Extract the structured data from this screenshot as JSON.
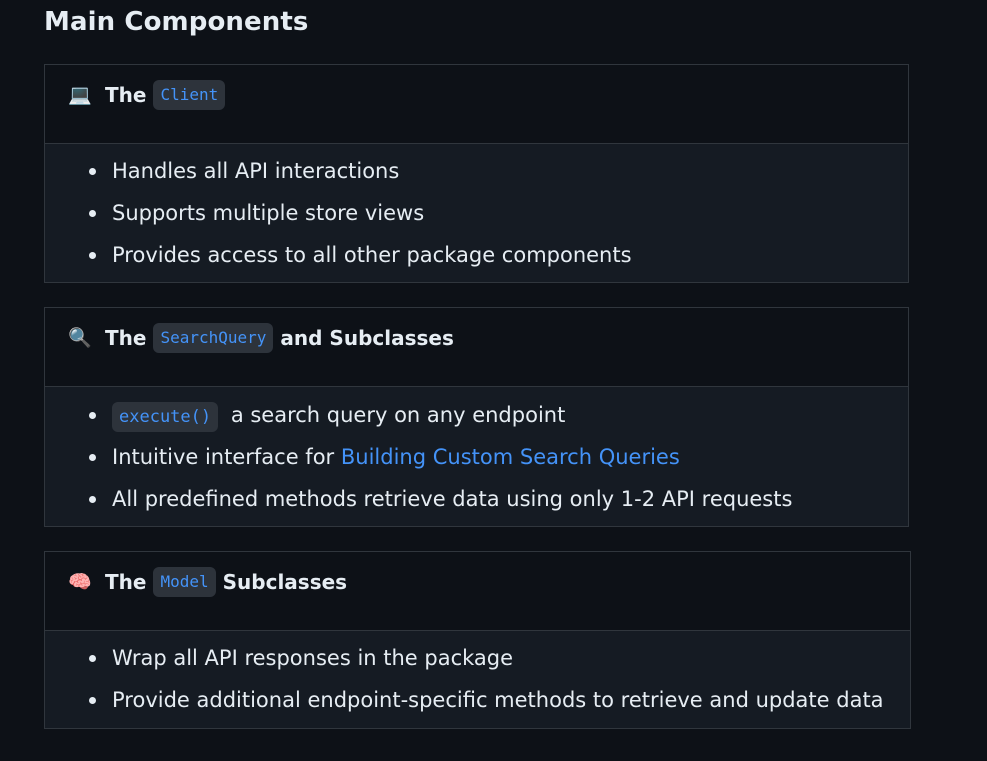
{
  "heading": "Main Components",
  "cards": [
    {
      "emoji": "💻",
      "title_prefix": "The",
      "code": "Client",
      "title_suffix": "",
      "items": [
        {
          "text": "Handles all API interactions"
        },
        {
          "text": "Supports multiple store views"
        },
        {
          "text": "Provides access to all other package components"
        }
      ]
    },
    {
      "emoji": "🔍",
      "title_prefix": "The",
      "code": "SearchQuery",
      "title_suffix": "and Subclasses",
      "items": [
        {
          "code": "execute()",
          "text": "a search query on any endpoint"
        },
        {
          "text": "Intuitive interface for",
          "link": "Building Custom Search Queries"
        },
        {
          "text": "All predefined methods retrieve data using only 1-2 API requests"
        }
      ]
    },
    {
      "emoji": "🧠",
      "title_prefix": "The",
      "code": "Model",
      "title_suffix": "Subclasses",
      "items": [
        {
          "text": "Wrap all API responses in the package"
        },
        {
          "text": "Provide additional endpoint-specific methods to retrieve and update data"
        }
      ]
    }
  ]
}
